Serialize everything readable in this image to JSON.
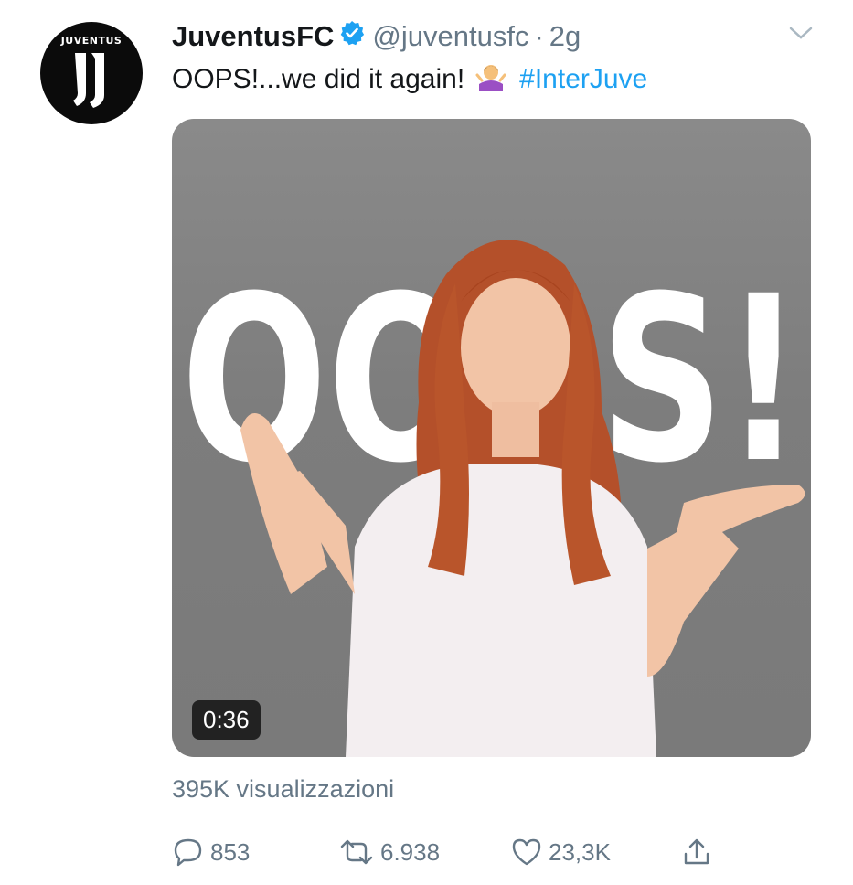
{
  "tweet": {
    "avatar_brand": "JUVENTUS",
    "display_name": "JuventusFC",
    "handle": "@juventusfc",
    "separator": "·",
    "time": "2g",
    "text_main": "OOPS!...we did it again!",
    "emoji": "person-shrugging",
    "hashtag": "#InterJuve",
    "accent_color": "#1da1f2"
  },
  "media": {
    "overlay_text": "OOPS!",
    "duration": "0:36"
  },
  "stats": {
    "views": "395K visualizzazioni",
    "replies": "853",
    "retweets": "6.938",
    "likes": "23,3K"
  }
}
